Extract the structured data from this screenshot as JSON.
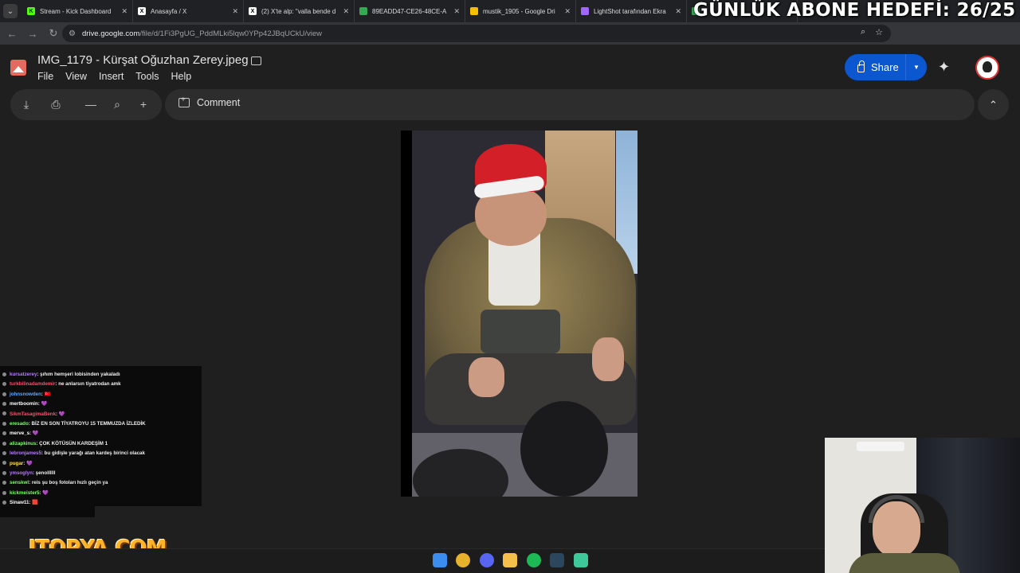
{
  "browser": {
    "tabs": [
      {
        "title": "Stream - Kick Dashboard",
        "favicon": "kick-icon",
        "color": "#53fc18",
        "glyph": "K"
      },
      {
        "title": "Anasayfa / X",
        "favicon": "x-icon",
        "color": "#ffffff",
        "glyph": "X"
      },
      {
        "title": "(2) X'te alp: \"valla bende d",
        "favicon": "x-icon",
        "color": "#ffffff",
        "glyph": "X"
      },
      {
        "title": "89EADD47-CE26-48CE-A",
        "favicon": "drive-icon",
        "color": "#34a853",
        "glyph": ""
      },
      {
        "title": "mustik_1905 - Google Dri",
        "favicon": "drive-icon",
        "color": "#fbbc04",
        "glyph": ""
      },
      {
        "title": "LightShot tarafından Ekra",
        "favicon": "lightshot-icon",
        "color": "#a066ff",
        "glyph": ""
      },
      {
        "title": "",
        "favicon": "drive-icon",
        "color": "#34a853",
        "glyph": ""
      }
    ],
    "url_host": "drive.google.com",
    "url_path": "/file/d/1Fi3PgUG_PddMLki5lqw0YPp42JBqUCkU/view"
  },
  "overlay_goal": "GÜNLÜK ABONE HEDEFİ: 26/25",
  "viewer": {
    "file_name": "IMG_1179 - Kürşat Oğuzhan Zerey.jpeg",
    "menus": [
      "File",
      "View",
      "Insert",
      "Tools",
      "Help"
    ],
    "share_label": "Share",
    "comment_label": "Comment"
  },
  "chat": [
    {
      "user": "kursatzerey",
      "color": "#b57cff",
      "msg": ": şıhım hemşeri lobisinden yakaladı"
    },
    {
      "user": "turkbilinadamdemir",
      "color": "#ff4d6d",
      "msg": ": ne anlarsın tiyatrodan amk"
    },
    {
      "user": "johnsnowden",
      "color": "#5ca8ff",
      "msg": ": 🇹🇷"
    },
    {
      "user": "mertboomin",
      "color": "#ffffff",
      "msg": ": 💜"
    },
    {
      "user": "SikmTasagimaBenk",
      "color": "#ff4d6d",
      "msg": ": 💜"
    },
    {
      "user": "eresado",
      "color": "#7dff6a",
      "msg": ": BİZ EN SON TİYATROYU 15 TEMMUZDA İZLEDİK"
    },
    {
      "user": "merve_s",
      "color": "#ffffff",
      "msg": ": 💜"
    },
    {
      "user": "alizapkinus",
      "color": "#7dff6a",
      "msg": ": ÇOK KÖTÜSÜN KARDEŞİM 1"
    },
    {
      "user": "lebronjames5",
      "color": "#b57cff",
      "msg": ": bu gidişle yarağı atan kardeş birinci olacak"
    },
    {
      "user": "pugar",
      "color": "#ffe14d",
      "msg": ": 💜"
    },
    {
      "user": "ymsoglyn",
      "color": "#b57cff",
      "msg": ": şenollllll"
    },
    {
      "user": "senskwl",
      "color": "#7dff6a",
      "msg": ": reis şu boş fotoları hızlı geçin ya"
    },
    {
      "user": "kickmeister5",
      "color": "#7dff6a",
      "msg": ": 💜"
    },
    {
      "user": "Sinaw11",
      "color": "#ffffff",
      "msg": ": 🟥"
    }
  ],
  "logo_text": "ITOPYA.COM"
}
